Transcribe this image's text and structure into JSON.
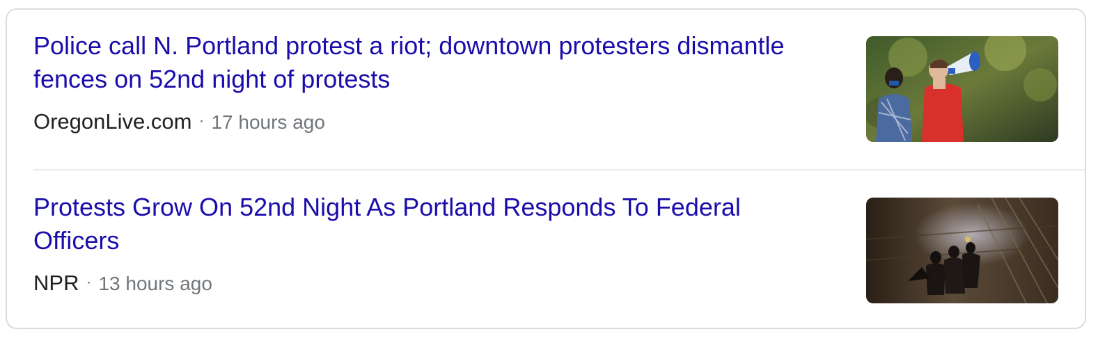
{
  "results": [
    {
      "headline": "Police call N. Portland protest a riot; downtown protesters dismantle fences on 52nd night of protests",
      "source": "OregonLive.com",
      "separator": "·",
      "time": "17 hours ago"
    },
    {
      "headline": "Protests Grow On 52nd Night As Portland Responds To Federal Officers",
      "source": "NPR",
      "separator": "·",
      "time": "13 hours ago"
    }
  ],
  "colors": {
    "link": "#1a0dab",
    "source_text": "#202124",
    "secondary_text": "#70757a",
    "card_border": "#dadce0"
  }
}
